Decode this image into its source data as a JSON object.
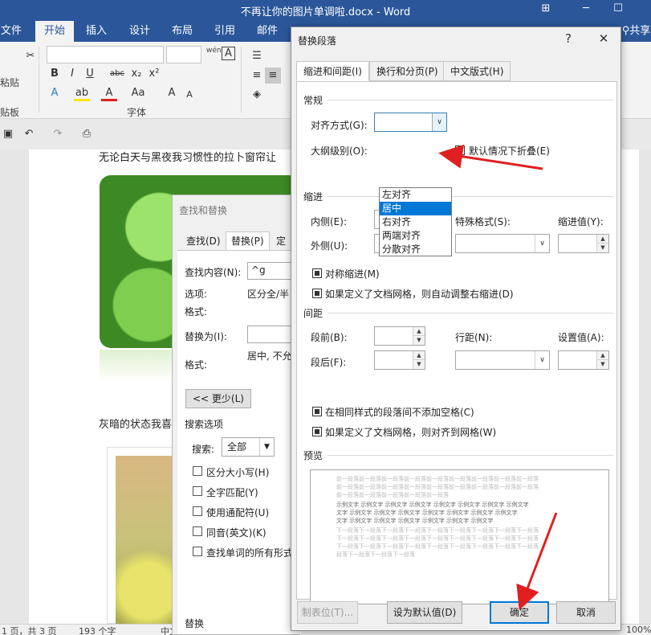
{
  "window": {
    "title": "不再让你的图片单调啦.docx - Word",
    "controls": [
      "⊞",
      "─",
      "☐"
    ]
  },
  "ribbon": {
    "tabs": [
      "文件",
      "开始",
      "插入",
      "设计",
      "布局",
      "引用",
      "邮件"
    ],
    "share": "共享",
    "paste_label": "粘贴",
    "clipboard_label": "贴板",
    "font_group_label": "字体",
    "font_buttons": [
      "B",
      "I",
      "U",
      "abc",
      "x₂",
      "x²",
      "A",
      "A",
      "Aa",
      "A",
      "A"
    ],
    "wen_label": "wén",
    "a_box": "A"
  },
  "document": {
    "line1": "无论白天与黑夜我习惯性的拉卜窗帘让",
    "line2": "灰暗的状态我喜",
    "status": [
      "1 页，共 3 页",
      "193 个字",
      "中文",
      "100%"
    ]
  },
  "find_replace": {
    "title": "查找和替换",
    "tabs": [
      "查找(D)",
      "替换(P)",
      "定位"
    ],
    "find_label": "查找内容(N):",
    "find_value": "^g",
    "options_label": "选项:",
    "options_value": "区分全/半",
    "format_label": "格式:",
    "replace_label": "替换为(I):",
    "replace_format_label": "格式:",
    "replace_format_value": "居中, 不允",
    "less_button": "<< 更少(L)",
    "search_options_label": "搜索选项",
    "search_label": "搜索:",
    "search_value": "全部",
    "checkboxes": [
      "区分大小写(H)",
      "全字匹配(Y)",
      "使用通配符(U)",
      "同音(英文)(K)",
      "查找单词的所有形式"
    ],
    "replace_section": "替换"
  },
  "paragraph": {
    "title": "替换段落",
    "help": "?",
    "close": "✕",
    "tabs": [
      "缩进和间距(I)",
      "换行和分页(P)",
      "中文版式(H)"
    ],
    "general": "常规",
    "align_label": "对齐方式(G):",
    "align_value": "",
    "outline_label": "大纲级别(O):",
    "collapse_label": "默认情况下折叠(E)",
    "align_options": [
      "左对齐",
      "居中",
      "右对齐",
      "两端对齐",
      "分散对齐"
    ],
    "align_selected_index": 1,
    "indent": "缩进",
    "inside_label": "内侧(E):",
    "outside_label": "外侧(U):",
    "special_label": "特殊格式(S):",
    "indent_value_label": "缩进值(Y):",
    "mirror_label": "对称缩进(M)",
    "auto_indent_label": "如果定义了文档网格，则自动调整右缩进(D)",
    "spacing": "间距",
    "before_label": "段前(B):",
    "after_label": "段后(F):",
    "line_spacing_label": "行距(N):",
    "set_value_label": "设置值(A):",
    "no_space_label": "在相同样式的段落间不添加空格(C)",
    "snap_grid_label": "如果定义了文档网格，则对齐到网格(W)",
    "preview": "预览",
    "preview_prev": "前一段落前一段落前一段落前一段落前一段落前一段落前一段落前一段落前一段落",
    "preview_prev_short": "前一段落前一段落前一段落前一段落前一段落",
    "preview_sample": "示例文字 示例文字 示例文字 示例文字 示例文字 示例文字 示例文字 示例文字",
    "preview_sample_short": "文字 示例文字 示例文字 示例文字 示例文字 示例文字 示例文字 示例文字",
    "preview_sample_end": "文字 示例文字 示例文字 示例文字 示例文字 示例文字 示例文字",
    "preview_next": "下一段落下一段落下一段落下一段落下一段落下一段落下一段落下一段落下一段落",
    "preview_next_short": "段落下一段落下一段落下一段落",
    "buttons": {
      "tabs": "制表位(T)...",
      "set_default": "设为默认值(D)",
      "ok": "确定",
      "cancel": "取消"
    }
  },
  "colors": {
    "word_blue": "#2b579a",
    "selection_blue": "#0078d7",
    "annotation_red": "#e02020"
  }
}
